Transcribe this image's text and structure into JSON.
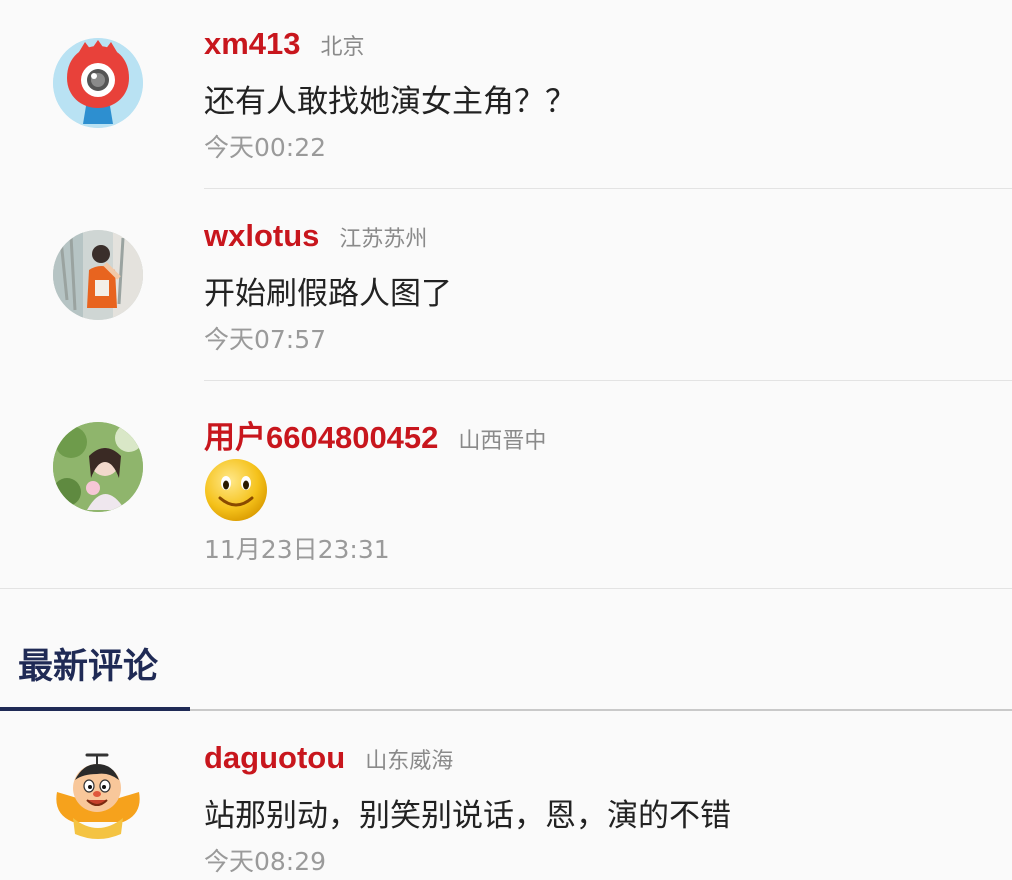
{
  "comments": [
    {
      "username": "xm413",
      "location": "北京",
      "text": "还有人敢找她演女主角？？",
      "time": "今天00:22",
      "avatar": "weibo-eye-icon"
    },
    {
      "username": "wxlotus",
      "location": "江苏苏州",
      "text": "开始刷假路人图了",
      "time": "今天07:57",
      "avatar": "photo-avatar"
    },
    {
      "username": "用户6604800452",
      "location": "山西晋中",
      "text": "",
      "emoji": "smiley-emoji-icon",
      "time": "11月23日23:31",
      "avatar": "photo-avatar"
    }
  ],
  "latest": {
    "title": "最新评论",
    "comments": [
      {
        "username": "daguotou",
        "location": "山东威海",
        "text": "站那别动，别笑别说话，恩，演的不错",
        "time": "今天08:29",
        "avatar": "cartoon-avatar"
      }
    ]
  },
  "colors": {
    "username": "#c8161d",
    "section_title": "#1f2a55",
    "meta": "#9a9a9a"
  }
}
